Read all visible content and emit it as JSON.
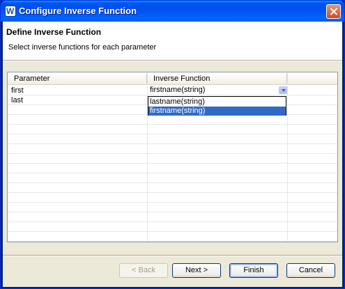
{
  "window": {
    "title": "Configure Inverse Function"
  },
  "header": {
    "title": "Define Inverse Function",
    "description": "Select inverse functions for each parameter"
  },
  "table": {
    "columns": [
      "Parameter",
      "Inverse Function"
    ],
    "rows": [
      {
        "parameter": "first",
        "inverse_function": "firstname(string)"
      },
      {
        "parameter": "last",
        "inverse_function": ""
      }
    ],
    "combo": {
      "selected": "firstname(string)",
      "options": [
        "lastname(string)",
        "firstname(string)"
      ],
      "highlighted_index": 1
    }
  },
  "buttons": {
    "back": "< Back",
    "next": "Next >",
    "finish": "Finish",
    "cancel": "Cancel"
  },
  "colors": {
    "selection": "#316ac5",
    "titlebar": "#0053ee"
  }
}
